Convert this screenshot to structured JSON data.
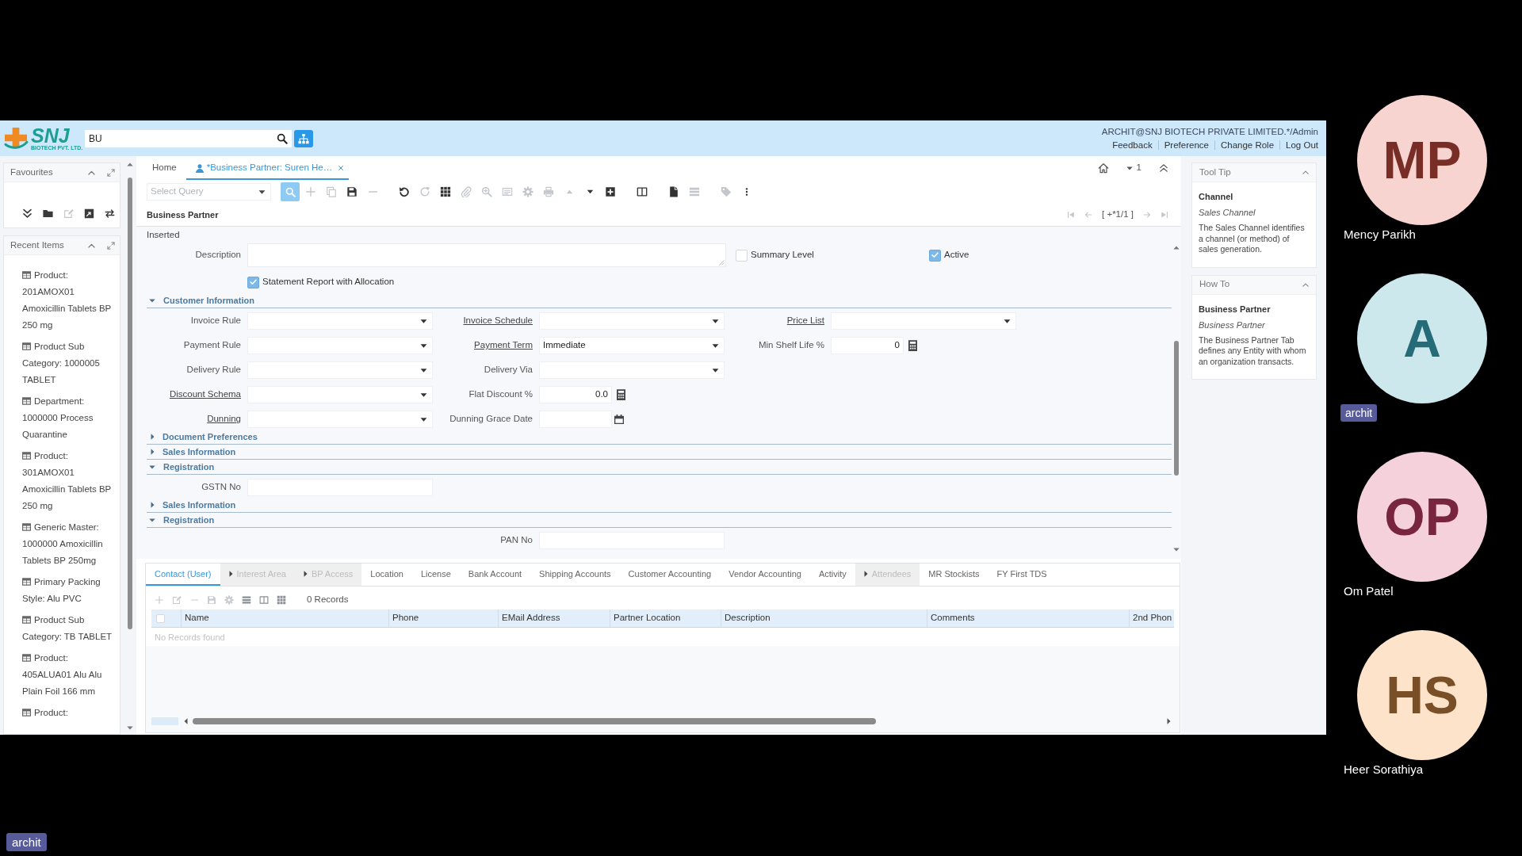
{
  "screen_share": {
    "header": {
      "logo": {
        "name": "SNJ",
        "tagline": "BIOTECH PVT. LTD."
      },
      "search": {
        "value": "BU"
      },
      "user": "ARCHIT@SNJ BIOTECH PRIVATE LIMITED.*/Admin",
      "links": [
        "Feedback",
        "Preference",
        "Change Role",
        "Log Out"
      ]
    },
    "sidebar": {
      "favourites": {
        "title": "Favourites",
        "tools": [
          {
            "kind": "collapse",
            "disabled": false
          },
          {
            "kind": "folder",
            "disabled": false
          },
          {
            "kind": "edit",
            "disabled": true
          },
          {
            "kind": "export",
            "disabled": false
          },
          {
            "kind": "sync",
            "disabled": false
          }
        ]
      },
      "recent_items": {
        "title": "Recent Items",
        "items": [
          "Product: 201AMOX01 Amoxicillin Tablets BP 250 mg",
          "Product Sub Category: 1000005 TABLET",
          "Department: 1000000 Process Quarantine",
          "Product: 301AMOX01 Amoxicillin Tablets BP 250 mg",
          "Generic Master: 1000000 Amoxicillin Tablets BP 250mg",
          "Primary Packing Style: Alu PVC",
          "Product Sub Category: TB TABLET",
          "Product: 405ALUA01 Alu Alu Plain Foil 166 mm",
          "Product:"
        ]
      }
    },
    "window_tabs": [
      {
        "label": "Home",
        "kind": "home",
        "selected": false
      },
      {
        "label": "*Business Partner: Suren He…",
        "kind": "window",
        "selected": true
      }
    ],
    "window_count": "1",
    "toolbar": {
      "query": {
        "placeholder": "Select Query"
      },
      "groups": [
        [
          {
            "kind": "search",
            "disabled": false
          },
          {
            "kind": "plus",
            "disabled": true
          },
          {
            "kind": "copy",
            "disabled": true
          },
          {
            "kind": "save",
            "disabled": false
          },
          {
            "kind": "minus",
            "disabled": true
          }
        ],
        [
          {
            "kind": "undo",
            "disabled": false
          },
          {
            "kind": "refresh",
            "disabled": true
          },
          {
            "kind": "grid",
            "disabled": false
          },
          {
            "kind": "clip",
            "disabled": true
          },
          {
            "kind": "zoom",
            "disabled": true
          },
          {
            "kind": "card",
            "disabled": true
          },
          {
            "kind": "gear",
            "disabled": true
          },
          {
            "kind": "printer",
            "disabled": true
          },
          {
            "kind": "up",
            "disabled": true
          },
          {
            "kind": "down",
            "disabled": false
          },
          {
            "kind": "addbox",
            "disabled": false
          }
        ],
        [
          {
            "kind": "columns",
            "disabled": false
          }
        ],
        [
          {
            "kind": "document",
            "disabled": false
          },
          {
            "kind": "list",
            "disabled": true
          }
        ],
        [
          {
            "kind": "tag",
            "disabled": true
          },
          {
            "kind": "more",
            "disabled": false
          }
        ]
      ]
    },
    "record": {
      "title": "Business Partner",
      "status": "Inserted",
      "nav": [
        {
          "kind": "first",
          "disabled": true
        },
        {
          "kind": "previous",
          "disabled": true
        },
        {
          "kind": "position",
          "label": "[ +*1/1 ]"
        },
        {
          "kind": "next",
          "disabled": true
        },
        {
          "kind": "last",
          "disabled": true
        }
      ]
    },
    "form": {
      "top_rows": [
        [
          {
            "kind": "textarea",
            "label": "Description",
            "linked": false
          },
          {
            "kind": "checkbox",
            "label": "Summary Level",
            "checked": false
          },
          {
            "kind": "checkbox",
            "label": "Active",
            "checked": true
          }
        ],
        [
          {
            "kind": "checkbox",
            "label": "Statement Report with Allocation",
            "checked": true
          }
        ]
      ],
      "sections": [
        {
          "title": "Customer Information",
          "expanded": true,
          "rows": [
            {
              "indented": false,
              "fields": [
                {
                  "label": "Invoice Rule",
                  "kind": "select",
                  "linked": false
                },
                {
                  "label": "Invoice Schedule",
                  "kind": "select",
                  "linked": true
                },
                {
                  "label": "Price List",
                  "kind": "select",
                  "linked": true
                }
              ]
            },
            {
              "indented": false,
              "fields": [
                {
                  "label": "Payment Rule",
                  "kind": "select",
                  "linked": false
                },
                {
                  "label": "Payment Term",
                  "kind": "select",
                  "linked": true,
                  "value": "Immediate"
                },
                {
                  "label": "Min Shelf Life %",
                  "kind": "number",
                  "linked": false,
                  "value": "0"
                }
              ]
            },
            {
              "indented": false,
              "fields": [
                {
                  "label": "Delivery Rule",
                  "kind": "select",
                  "linked": false
                },
                {
                  "label": "Delivery Via",
                  "kind": "select",
                  "linked": false
                }
              ]
            },
            {
              "indented": false,
              "fields": [
                {
                  "label": "Discount Schema",
                  "kind": "select",
                  "linked": true
                },
                {
                  "label": "Flat Discount %",
                  "kind": "number",
                  "linked": false,
                  "value": "0.0"
                }
              ]
            },
            {
              "indented": false,
              "fields": [
                {
                  "label": "Dunning",
                  "kind": "select",
                  "linked": true
                },
                {
                  "label": "Dunning Grace Date",
                  "kind": "date",
                  "linked": false
                }
              ]
            }
          ]
        },
        {
          "title": "Document Preferences",
          "expanded": false
        },
        {
          "title": "Sales Information",
          "expanded": false
        },
        {
          "title": "Registration",
          "expanded": true,
          "rows": [
            {
              "indented": false,
              "fields": [
                {
                  "label": "GSTN No",
                  "kind": "text",
                  "linked": false
                }
              ]
            }
          ]
        },
        {
          "title": "Sales Information",
          "expanded": false
        },
        {
          "title": "Registration",
          "expanded": true,
          "rows": [
            {
              "indented": true,
              "fields": [
                {
                  "label": "PAN No",
                  "kind": "text",
                  "linked": false
                }
              ]
            }
          ]
        }
      ]
    },
    "detail": {
      "tabs": [
        {
          "label": "Contact (User)",
          "selected": true,
          "disabled": false,
          "expandable": false
        },
        {
          "label": "Interest Area",
          "selected": false,
          "disabled": true,
          "expandable": true
        },
        {
          "label": "BP Access",
          "selected": false,
          "disabled": true,
          "expandable": true
        },
        {
          "label": "Location",
          "selected": false,
          "disabled": false,
          "expandable": false
        },
        {
          "label": "License",
          "selected": false,
          "disabled": false,
          "expandable": false
        },
        {
          "label": "Bank Account",
          "selected": false,
          "disabled": false,
          "expandable": false
        },
        {
          "label": "Shipping Accounts",
          "selected": false,
          "disabled": false,
          "expandable": false
        },
        {
          "label": "Customer Accounting",
          "selected": false,
          "disabled": false,
          "expandable": false
        },
        {
          "label": "Vendor Accounting",
          "selected": false,
          "disabled": false,
          "expandable": false
        },
        {
          "label": "Activity",
          "selected": false,
          "disabled": false,
          "expandable": false
        },
        {
          "label": "Attendees",
          "selected": false,
          "disabled": true,
          "expandable": true
        },
        {
          "label": "MR Stockists",
          "selected": false,
          "disabled": false,
          "expandable": false
        },
        {
          "label": "FY First TDS",
          "selected": false,
          "disabled": false,
          "expandable": false
        }
      ],
      "tools": [
        {
          "kind": "plus",
          "disabled": true
        },
        {
          "kind": "edit",
          "disabled": true
        },
        {
          "kind": "minus",
          "disabled": true
        },
        {
          "kind": "save",
          "disabled": true
        },
        {
          "kind": "gear",
          "disabled": true
        },
        {
          "kind": "list",
          "disabled": false
        },
        {
          "kind": "columns",
          "disabled": false
        },
        {
          "kind": "grid",
          "disabled": false
        }
      ],
      "record_count": "0 Records",
      "select_all": {
        "checked": false
      },
      "columns": [
        "Name",
        "Phone",
        "EMail Address",
        "Partner Location",
        "Description",
        "Comments",
        "2nd Phon"
      ],
      "empty_message": "No Records found"
    },
    "help_panels": [
      {
        "title": "Tool Tip",
        "heading": "Channel",
        "subheading": "Sales Channel",
        "text": "The Sales Channel identifies a channel (or method) of sales generation."
      },
      {
        "title": "How To",
        "heading": "Business Partner",
        "subheading": "Business Partner",
        "text": "The Business Partner Tab defines any Entity with whom an organization transacts."
      }
    ]
  },
  "participants": [
    {
      "initials": "MP",
      "name": "Mency Parikh",
      "color": "#f8d4d1",
      "kind": "plain"
    },
    {
      "initials": "A",
      "name": "archit",
      "color": "#cce8ed",
      "kind": "badge"
    },
    {
      "initials": "OP",
      "name": "Om Patel",
      "color": "#f5d1dc",
      "kind": "plain"
    },
    {
      "initials": "HS",
      "name": "Heer Sorathiya",
      "color": "#fce3ca",
      "kind": "plain"
    }
  ],
  "self_view": {
    "name": "archit"
  }
}
